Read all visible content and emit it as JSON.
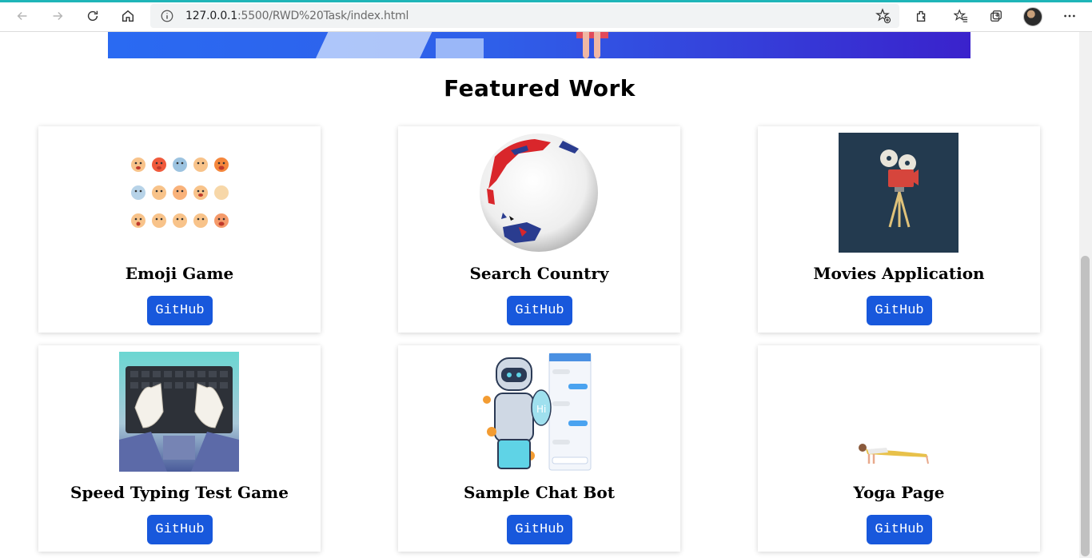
{
  "browser": {
    "url_host": "127.0.0.1",
    "url_rest": ":5500/RWD%20Task/index.html"
  },
  "section": {
    "title": "Featured Work"
  },
  "projects": [
    {
      "name": "Emoji Game",
      "button": "GitHub"
    },
    {
      "name": "Search Country",
      "button": "GitHub"
    },
    {
      "name": "Movies Application",
      "button": "GitHub"
    },
    {
      "name": "Speed Typing Test Game",
      "button": "GitHub"
    },
    {
      "name": "Sample Chat Bot",
      "button": "GitHub"
    },
    {
      "name": "Yoga Page",
      "button": "GitHub"
    }
  ],
  "colors": {
    "button": "#1858dc",
    "accent": "#1fb5b8"
  },
  "icons": [
    "back-icon",
    "forward-icon",
    "reload-icon",
    "home-icon",
    "info-icon",
    "add-favorite-icon",
    "extensions-icon",
    "favorites-icon",
    "collections-icon",
    "more-icon"
  ]
}
